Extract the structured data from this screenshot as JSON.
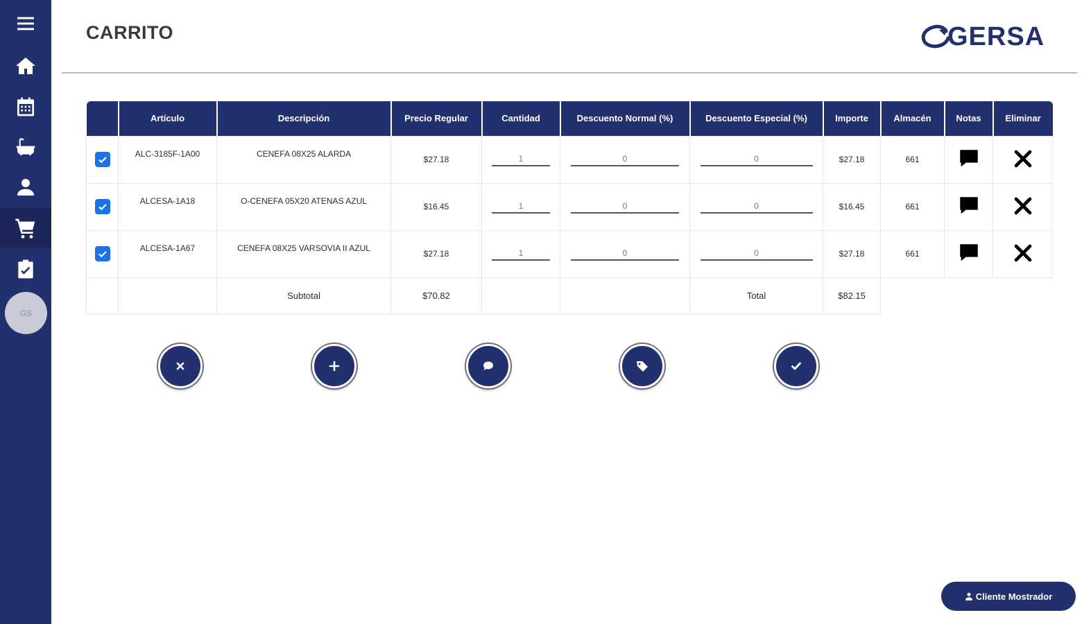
{
  "header": {
    "title": "CARRITO",
    "logo_text": "GERSA"
  },
  "sidebar": {
    "items": [
      {
        "name": "menu-icon"
      },
      {
        "name": "home-icon"
      },
      {
        "name": "calendar-icon"
      },
      {
        "name": "bathtub-icon"
      },
      {
        "name": "user-icon"
      },
      {
        "name": "cart-icon",
        "active": true
      },
      {
        "name": "clipboard-check-icon"
      }
    ],
    "avatar_initials": "GS"
  },
  "table": {
    "headers": [
      "",
      "Artículo",
      "Descripción",
      "Precio Regular",
      "Cantidad",
      "Descuento Normal (%)",
      "Descuento Especial (%)",
      "Importe",
      "Almacén",
      "Notas",
      "Eliminar"
    ],
    "rows": [
      {
        "checked": true,
        "articulo": "ALC-3185F-1A00",
        "descripcion": "CENEFA 08X25 ALARDA",
        "precio": "$27.18",
        "cantidad": "1",
        "desc_normal": "0",
        "desc_especial": "0",
        "importe": "$27.18",
        "almacen": "661"
      },
      {
        "checked": true,
        "articulo": "ALCESA-1A18",
        "descripcion": "O-CENEFA 05X20 ATENAS AZUL",
        "precio": "$16.45",
        "cantidad": "1",
        "desc_normal": "0",
        "desc_especial": "0",
        "importe": "$16.45",
        "almacen": "661"
      },
      {
        "checked": true,
        "articulo": "ALCESA-1A67",
        "descripcion": "CENEFA 08X25 VARSOVIA II AZUL",
        "precio": "$27.18",
        "cantidad": "1",
        "desc_normal": "0",
        "desc_especial": "0",
        "importe": "$27.18",
        "almacen": "661"
      }
    ],
    "summary": {
      "subtotal_label": "Subtotal",
      "subtotal_value": "$70.82",
      "total_label": "Total",
      "total_value": "$82.15"
    }
  },
  "actions": [
    {
      "name": "clear-cart-button",
      "icon": "close-icon"
    },
    {
      "name": "add-item-button",
      "icon": "plus-icon"
    },
    {
      "name": "add-note-button",
      "icon": "chat-icon"
    },
    {
      "name": "apply-discount-button",
      "icon": "tag-icon"
    },
    {
      "name": "confirm-order-button",
      "icon": "check-icon"
    }
  ],
  "client_button": {
    "label": "Cliente Mostrador"
  },
  "colors": {
    "brand": "#23306e",
    "checkbox": "#1a73e8"
  }
}
